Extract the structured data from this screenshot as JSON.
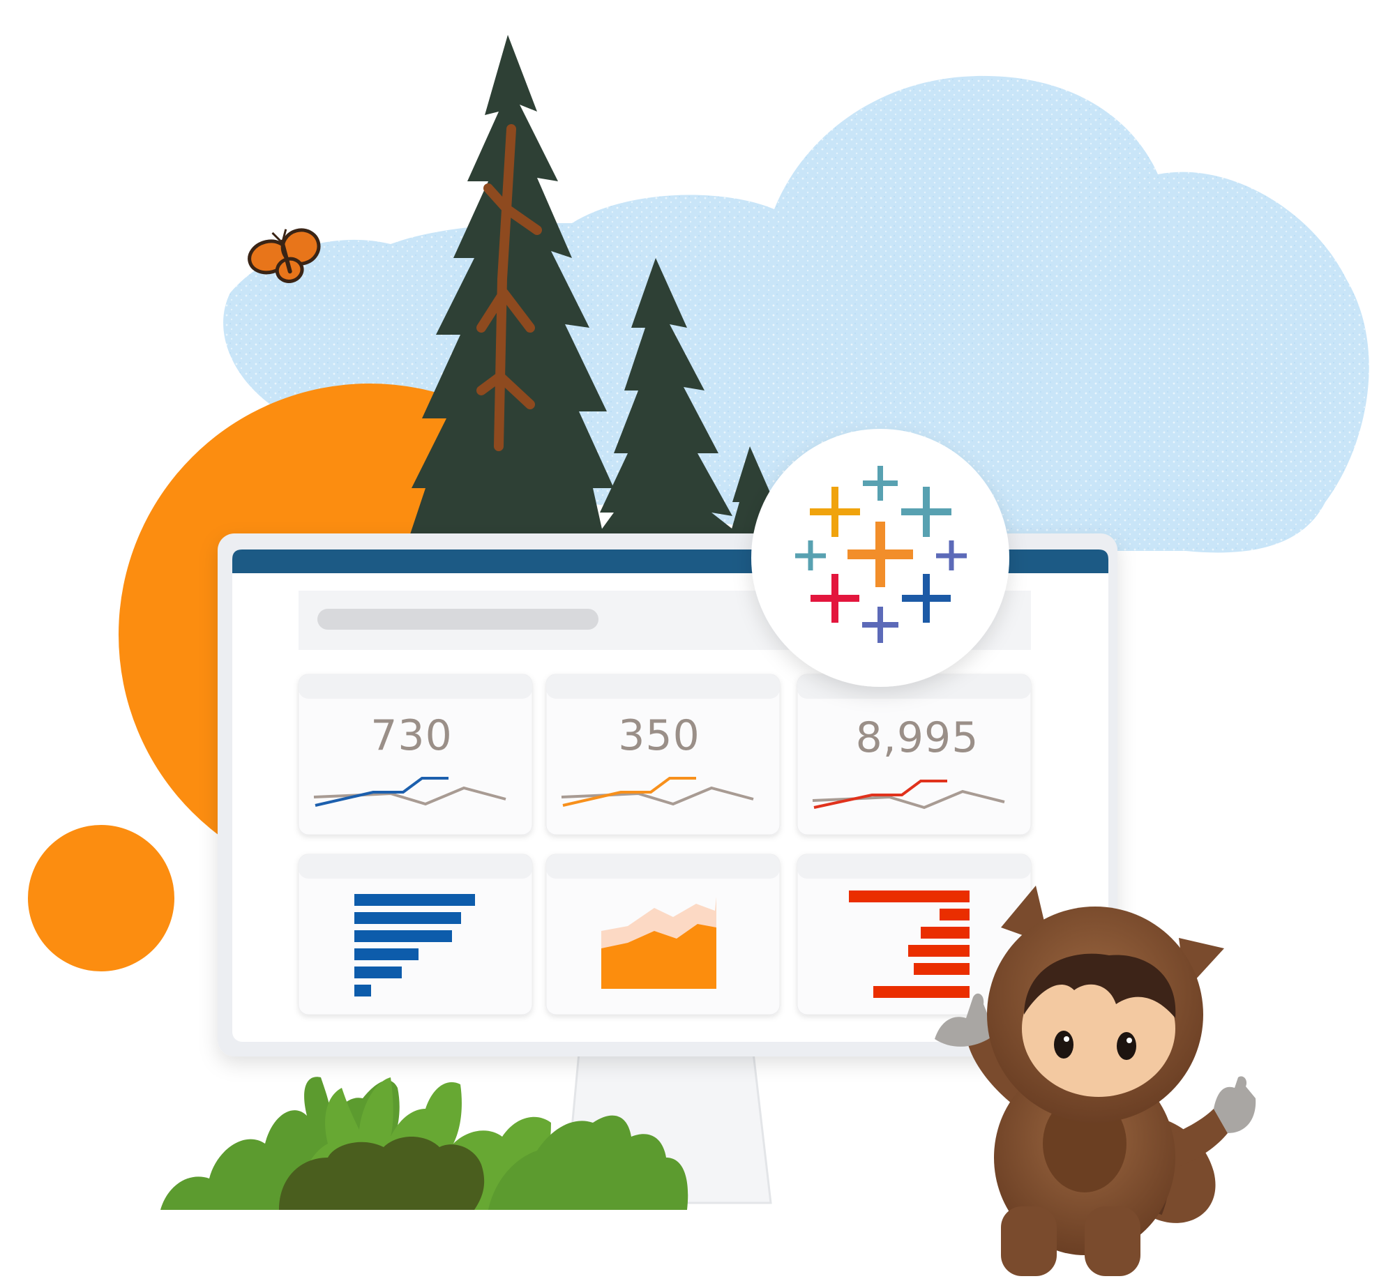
{
  "illustration": {
    "dashboard": {
      "metrics": [
        {
          "value": "730",
          "line_color": "#1b5fad"
        },
        {
          "value": "350",
          "line_color": "#f7901e"
        },
        {
          "value": "8,995",
          "line_color": "#e0301e"
        }
      ],
      "trend_baseline_color": "#a89b93",
      "bar_color_blue": "#0b5cab",
      "area_color_orange": "#fe9339",
      "bar_color_red": "#ea2d00",
      "header_color": "#1b5a85"
    },
    "logo": {
      "name": "tableau-plus-logo"
    },
    "colors": {
      "sun": "#fc8d10",
      "tree": "#2e4035",
      "trunk": "#8e4a1f",
      "cloud": "#bfe0f7",
      "bush_light": "#5c9b2f",
      "bush_dark": "#4a5e1e",
      "mascot_fur": "#7a4b2d"
    }
  }
}
